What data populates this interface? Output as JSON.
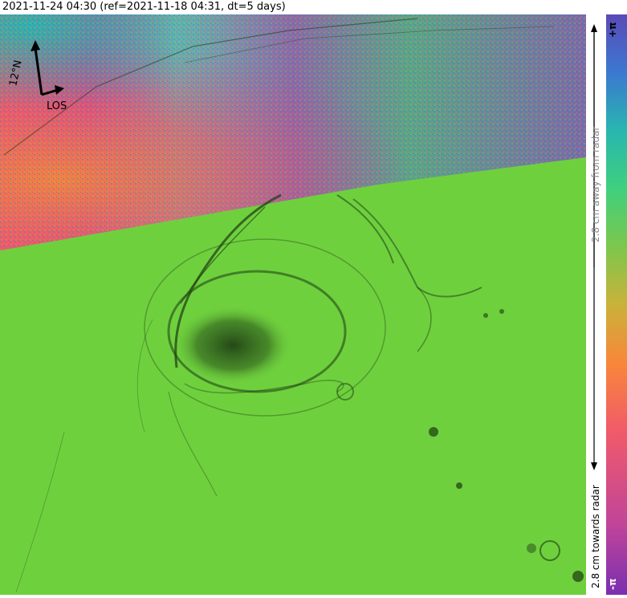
{
  "title": "2021-11-24 04:30 (ref=2021-11-18 04:31, dt=5 days)",
  "north_arrow": {
    "label": "12°N",
    "los_label": "LOS"
  },
  "colorbar": {
    "top_label": "+π",
    "bottom_label": "-π",
    "away_label": "2.8 cm away from radar",
    "towards_label": "2.8 cm towards radar",
    "colors": [
      "#7a2fb0",
      "#c0449a",
      "#f05a6a",
      "#f8873a",
      "#c9b23a",
      "#7cc74c",
      "#3fd07e",
      "#28b6b0",
      "#3b78d0",
      "#5a4ab8"
    ]
  },
  "map": {
    "base_color": "#6fd03e",
    "shadow_color": "#1c3a12"
  }
}
